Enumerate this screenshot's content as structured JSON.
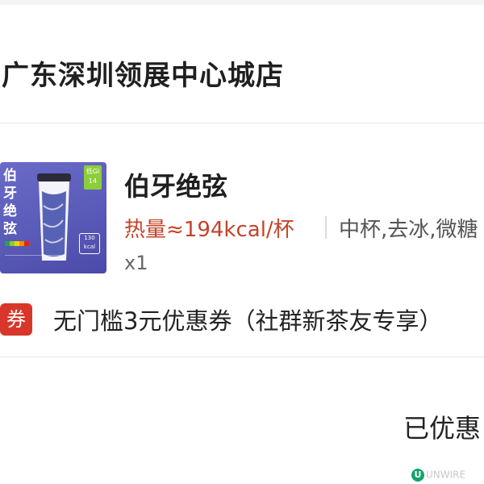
{
  "store": {
    "name": "广东深圳领展中心城店"
  },
  "product": {
    "name": "伯牙绝弦",
    "calorie": "热量≈194kcal/杯",
    "specs": "中杯,去冰,微糖",
    "quantity": "x1",
    "image": {
      "calligraphy": "伯牙绝弦",
      "gi_badge": "低GI 14",
      "kcal_tag": "130 kcal"
    }
  },
  "coupon": {
    "icon_label": "券",
    "text": "无门槛3元优惠券（社群新茶友专享）"
  },
  "summary": {
    "discount_label": "已优惠"
  },
  "watermark": {
    "icon": "U",
    "text": "UNWIRE"
  },
  "colors": {
    "accent_red": "#c4432b",
    "coupon_red": "#d8362a",
    "product_bg": "#5a5ab8"
  }
}
